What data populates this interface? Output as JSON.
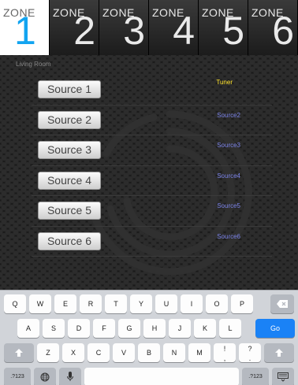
{
  "zones": [
    {
      "label": "ZONE",
      "number": "1"
    },
    {
      "label": "ZONE",
      "number": "2"
    },
    {
      "label": "ZONE",
      "number": "3"
    },
    {
      "label": "ZONE",
      "number": "4"
    },
    {
      "label": "ZONE",
      "number": "5"
    },
    {
      "label": "ZONE",
      "number": "6"
    }
  ],
  "active_zone": 1,
  "panel": {
    "subheading": "Living Room"
  },
  "sources": [
    {
      "button": "Source 1",
      "name": "Tuner"
    },
    {
      "button": "Source 2",
      "name": "Source2"
    },
    {
      "button": "Source 3",
      "name": "Source3"
    },
    {
      "button": "Source 4",
      "name": "Source4"
    },
    {
      "button": "Source 5",
      "name": "Source5"
    },
    {
      "button": "Source 6",
      "name": "Source6"
    }
  ],
  "keyboard": {
    "row1": [
      "Q",
      "W",
      "E",
      "R",
      "T",
      "Y",
      "U",
      "I",
      "O",
      "P"
    ],
    "row2": [
      "A",
      "S",
      "D",
      "F",
      "G",
      "H",
      "J",
      "K",
      "L"
    ],
    "row3": [
      "Z",
      "X",
      "C",
      "V",
      "B",
      "N",
      "M",
      "!",
      ",",
      "?",
      "."
    ],
    "go_label": "Go",
    "numbers_label": ".?123"
  },
  "colors": {
    "accent": "#12a4f0",
    "tuner": "#ffe22a",
    "source_name": "#7b83e8",
    "go": "#1a82f6"
  }
}
